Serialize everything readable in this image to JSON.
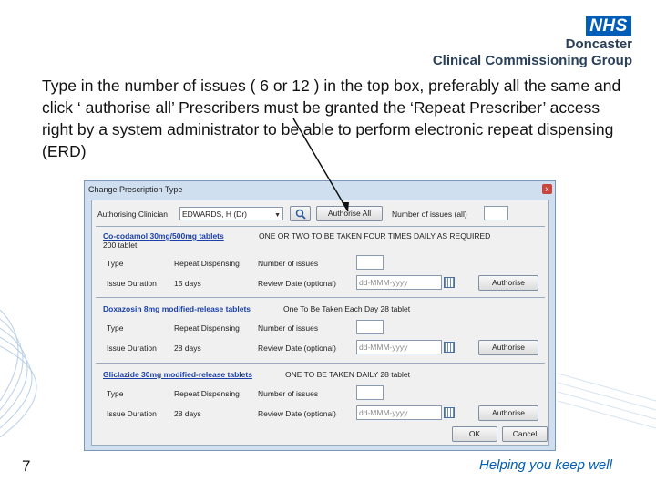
{
  "branding": {
    "nhs": "NHS",
    "org_line1": "Doncaster",
    "org_line2": "Clinical Commissioning Group",
    "tagline": "Helping you keep well"
  },
  "instruction": "Type in the number of issues ( 6 or 12 ) in the top box, preferably all the same and click ‘ authorise all’ Prescribers must be granted the ‘Repeat Prescriber’ access right by a system administrator to be able to perform electronic repeat dispensing (ERD)",
  "slide_number": "7",
  "dialog": {
    "title": "Change Prescription Type",
    "authorising_clinician_label": "Authorising Clinician",
    "authorising_clinician_value": "EDWARDS, H (Dr)",
    "authorise_all_label": "Authorise All",
    "number_of_issues_all_label": "Number of issues (all)",
    "items": [
      {
        "drug": "Co-codamol 30mg/500mg tablets",
        "directions": "ONE OR TWO TO BE TAKEN FOUR TIMES DAILY AS REQUIRED",
        "quantity": "200 tablet",
        "type_label": "Type",
        "type_value": "Repeat Dispensing",
        "issues_label": "Number of issues",
        "duration_label": "Issue Duration",
        "duration_value": "15 days",
        "review_label": "Review Date (optional)",
        "review_placeholder": "dd-MMM-yyyy",
        "authorise_label": "Authorise"
      },
      {
        "drug": "Doxazosin 8mg modified-release tablets",
        "directions": "One To Be Taken Each Day  28 tablet",
        "type_label": "Type",
        "type_value": "Repeat Dispensing",
        "issues_label": "Number of issues",
        "duration_label": "Issue Duration",
        "duration_value": "28 days",
        "review_label": "Review Date (optional)",
        "review_placeholder": "dd-MMM-yyyy",
        "authorise_label": "Authorise"
      },
      {
        "drug": "Gliclazide 30mg modified-release tablets",
        "directions": "ONE TO BE TAKEN DAILY  28 tablet",
        "type_label": "Type",
        "type_value": "Repeat Dispensing",
        "issues_label": "Number of issues",
        "duration_label": "Issue Duration",
        "duration_value": "28 days",
        "review_label": "Review Date (optional)",
        "review_placeholder": "dd-MMM-yyyy",
        "authorise_label": "Authorise"
      }
    ],
    "ok_label": "OK",
    "cancel_label": "Cancel",
    "close_symbol": "x"
  },
  "colors": {
    "nhs_blue": "#005eb8",
    "dialog_frame": "#cfdff0",
    "drug_link": "#1a3fa8"
  }
}
